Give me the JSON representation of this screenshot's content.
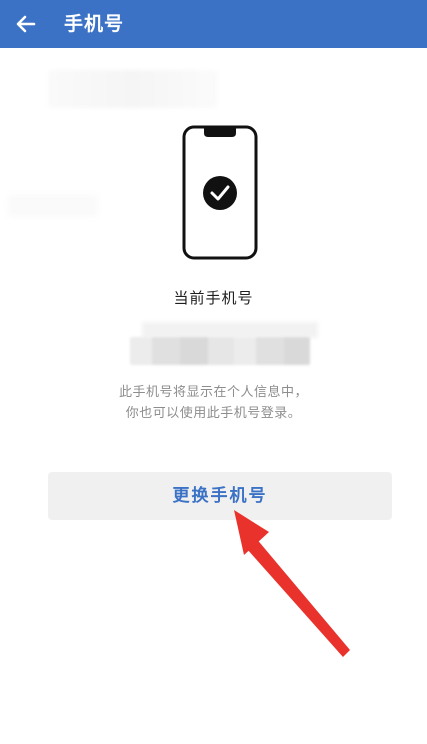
{
  "header": {
    "title": "手机号",
    "back_icon": "arrow-left-icon",
    "background_color": "#3b72c6"
  },
  "main": {
    "illustration_icon": "phone-check-icon",
    "current_label": "当前手机号",
    "hint_line1": "此手机号将显示在个人信息中，",
    "hint_line2": "你也可以使用此手机号登录。",
    "change_button_label": "更换手机号",
    "accent_color": "#3b72c6"
  },
  "annotation": {
    "arrow_color": "#e8322b"
  }
}
